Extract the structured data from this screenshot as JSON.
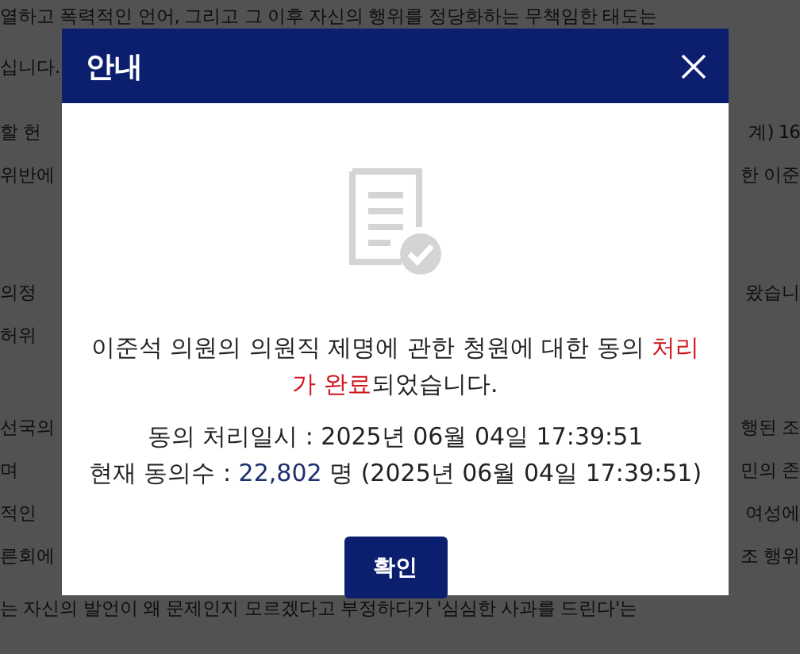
{
  "background_lines": [
    {
      "left": "열하고 폭력적인 언어, 그리고 그 이후 자신의 행위를 정당화하는 무책임한 태도는"
    },
    {
      "left": "십니다."
    },
    {
      "left": "할 헌",
      "right": "계) 16"
    },
    {
      "left": "위반에",
      "right": "한 이준"
    },
    {
      "left": "의정",
      "right": "왔습니"
    },
    {
      "left": "허위"
    },
    {
      "left": "선국의",
      "right": "행된 조"
    },
    {
      "left": "며",
      "right": "민의 존"
    },
    {
      "left": "적인",
      "right": "여성에"
    },
    {
      "left": "른회에",
      "right": "조 행위"
    },
    {
      "left": "는 자신의 발언이 왜 문제인지 모르겠다고 부정하다가 '심심한 사과를 드린다'는"
    }
  ],
  "dialog": {
    "title": "안내",
    "message": [
      {
        "text": "이준석 의원의 의원직 제명에 관한 청원에 대한 동의 ",
        "emphasis": false
      },
      {
        "text": "처리가 완료",
        "emphasis": true
      },
      {
        "text": "되었습니다.",
        "emphasis": false
      }
    ],
    "processed": {
      "label": "동의 처리일시 : ",
      "value": "2025년 06월 04일 17:39:51"
    },
    "count": {
      "label": "현재 동의수 : ",
      "value": "22,802",
      "suffix": " 명 (2025년 06월 04일 17:39:51)"
    },
    "button": "확인"
  }
}
